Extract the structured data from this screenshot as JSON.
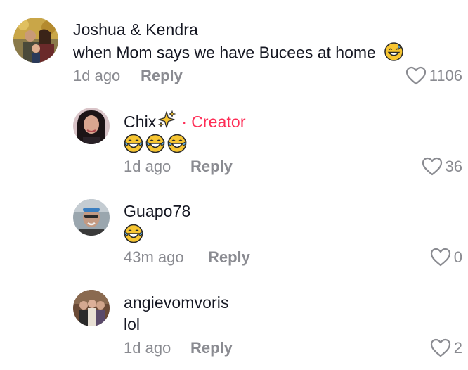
{
  "comments": [
    {
      "username": "Joshua & Kendra",
      "text": "when Mom says we have Bucees at home",
      "emoji": "grinning-sweat",
      "time": "1d ago",
      "reply_label": "Reply",
      "likes": "1106"
    },
    {
      "username": "Chix",
      "badge_separator": "·",
      "badge": "Creator",
      "emoji": "tears-of-joy x3",
      "time": "1d ago",
      "reply_label": "Reply",
      "likes": "36"
    },
    {
      "username": "Guapo78",
      "emoji": "tears-of-joy",
      "time": "43m ago",
      "reply_label": "Reply",
      "likes": "0"
    },
    {
      "username": "angievomvoris",
      "text": "lol",
      "time": "1d ago",
      "reply_label": "Reply",
      "likes": "2"
    }
  ],
  "colors": {
    "text": "#161823",
    "secondary": "#8a8b91",
    "creator": "#fe2c55"
  }
}
